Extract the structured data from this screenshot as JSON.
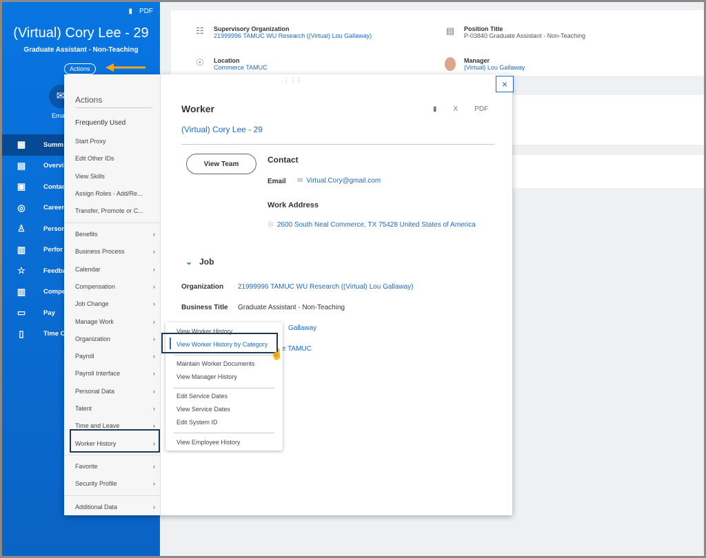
{
  "header": {
    "name": "(Virtual) Cory Lee - 29",
    "subtitle": "Graduate Assistant - Non-Teaching",
    "actions_label": "Actions",
    "email_label": "Ema",
    "pdf_label": "PDF"
  },
  "sidebar": {
    "items": [
      {
        "label": "Summ",
        "icon": "grid-icon"
      },
      {
        "label": "Overvie",
        "icon": "document-icon"
      },
      {
        "label": "Contac",
        "icon": "contact-card-icon"
      },
      {
        "label": "Career",
        "icon": "target-icon"
      },
      {
        "label": "Person",
        "icon": "person-icon"
      },
      {
        "label": "Perfor",
        "icon": "clipboard-chart-icon"
      },
      {
        "label": "Feedba",
        "icon": "star-icon"
      },
      {
        "label": "Compe",
        "icon": "chart-icon"
      },
      {
        "label": "Pay",
        "icon": "wallet-icon"
      },
      {
        "label": "Time O",
        "icon": "luggage-icon"
      }
    ]
  },
  "summary": {
    "sup_org_label": "Supervisory Organization",
    "sup_org_value": "21999996 TAMUC WU Research ((Virtual) Lou Gallaway)",
    "position_label": "Position Title",
    "position_value": "P-03840 Graduate Assistant - Non-Teaching",
    "location_label": "Location",
    "location_value": "Commerce TAMUC",
    "manager_label": "Manager",
    "manager_value": "(Virtual) Lou Gallaway"
  },
  "actions_menu": {
    "title": "Actions",
    "frequent_title": "Frequently Used",
    "frequent": [
      "Start Proxy",
      "Edit Other IDs",
      "View Skills",
      "Assign Roles - Add/Re...",
      "Transfer, Promote or C..."
    ],
    "groups": [
      "Benefits",
      "Business Process",
      "Calendar",
      "Compensation",
      "Job Change",
      "Manage Work",
      "Organization",
      "Payroll",
      "Payroll Interface",
      "Personal Data",
      "Talent",
      "Time and Leave",
      "Worker History"
    ],
    "groups2": [
      "Favorite",
      "Security Profile"
    ],
    "groups3": [
      "Additional Data"
    ],
    "chevron": "›"
  },
  "submenu": {
    "items": [
      "View Worker History",
      "View Worker History by Category",
      "Maintain Worker Documents",
      "View Manager History",
      "Edit Service Dates",
      "View Service Dates",
      "Edit System ID",
      "View Employee History"
    ],
    "highlighted": "View Worker History by Category"
  },
  "worker": {
    "title": "Worker",
    "name": "(Virtual) Cory Lee - 29",
    "view_team": "View Team",
    "contact_title": "Contact",
    "email_label": "Email",
    "email_value": "Virtual.Cory@gmail.com",
    "work_address_title": "Work Address",
    "address": "2600 South Neal Commerce, TX 75428 United States of America",
    "job_title": "Job",
    "org_label": "Organization",
    "org_value": "21999996 TAMUC WU Research ((Virtual) Lou Gallaway)",
    "bt_label": "Business Title",
    "bt_value": "Graduate Assistant - Non-Teaching",
    "partial1": "Gallaway",
    "partial2": "e TAMUC",
    "pdf_label": "PDF",
    "excel_label": "X",
    "close": "×"
  },
  "colors": {
    "brand_blue": "#0875e1",
    "link": "#1e6ac4",
    "arrow": "#f5a623",
    "highlight_border": "#1f3556"
  }
}
